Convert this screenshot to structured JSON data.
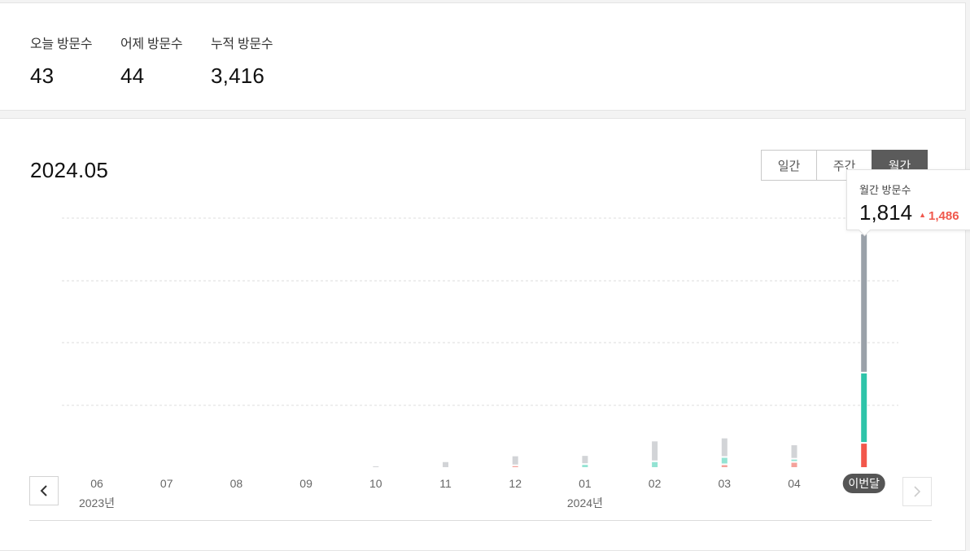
{
  "stats": [
    {
      "label": "오늘 방문수",
      "value": "43"
    },
    {
      "label": "어제 방문수",
      "value": "44"
    },
    {
      "label": "누적 방문수",
      "value": "3,416"
    }
  ],
  "period_title": "2024.05",
  "toggles": [
    {
      "label": "일간",
      "active": false
    },
    {
      "label": "주간",
      "active": false
    },
    {
      "label": "월간",
      "active": true
    }
  ],
  "tooltip": {
    "label": "월간 방문수",
    "value": "1,814",
    "delta": "1,486"
  },
  "colors": {
    "gray": "#9aa1a9",
    "gray_light": "#d2d4d7",
    "teal": "#2ec4a9",
    "teal_light": "#93e3d3",
    "red": "#f2574b",
    "red_light": "#f4a29b",
    "grid": "#dddddd",
    "pill": "#555555"
  },
  "icons": {
    "prev": "chevron-left-icon",
    "next": "chevron-right-icon"
  },
  "chart_data": {
    "type": "bar",
    "stacked": true,
    "categories": [
      "06",
      "07",
      "08",
      "09",
      "10",
      "11",
      "12",
      "01",
      "02",
      "03",
      "04",
      "이번달"
    ],
    "year_labels": [
      {
        "index": 0,
        "label": "2023년"
      },
      {
        "index": 7,
        "label": "2024년"
      }
    ],
    "series": [
      {
        "values": [
          0,
          0,
          0,
          0,
          2,
          40,
          65,
          58,
          150,
          140,
          100,
          1082
        ]
      },
      {
        "values": [
          0,
          0,
          0,
          0,
          0,
          0,
          0,
          18,
          40,
          45,
          12,
          540
        ]
      },
      {
        "values": [
          0,
          0,
          0,
          0,
          0,
          0,
          8,
          0,
          0,
          16,
          35,
          185
        ]
      }
    ],
    "highlight_index": 11,
    "ylim": [
      0,
      1960
    ],
    "grid": true
  }
}
